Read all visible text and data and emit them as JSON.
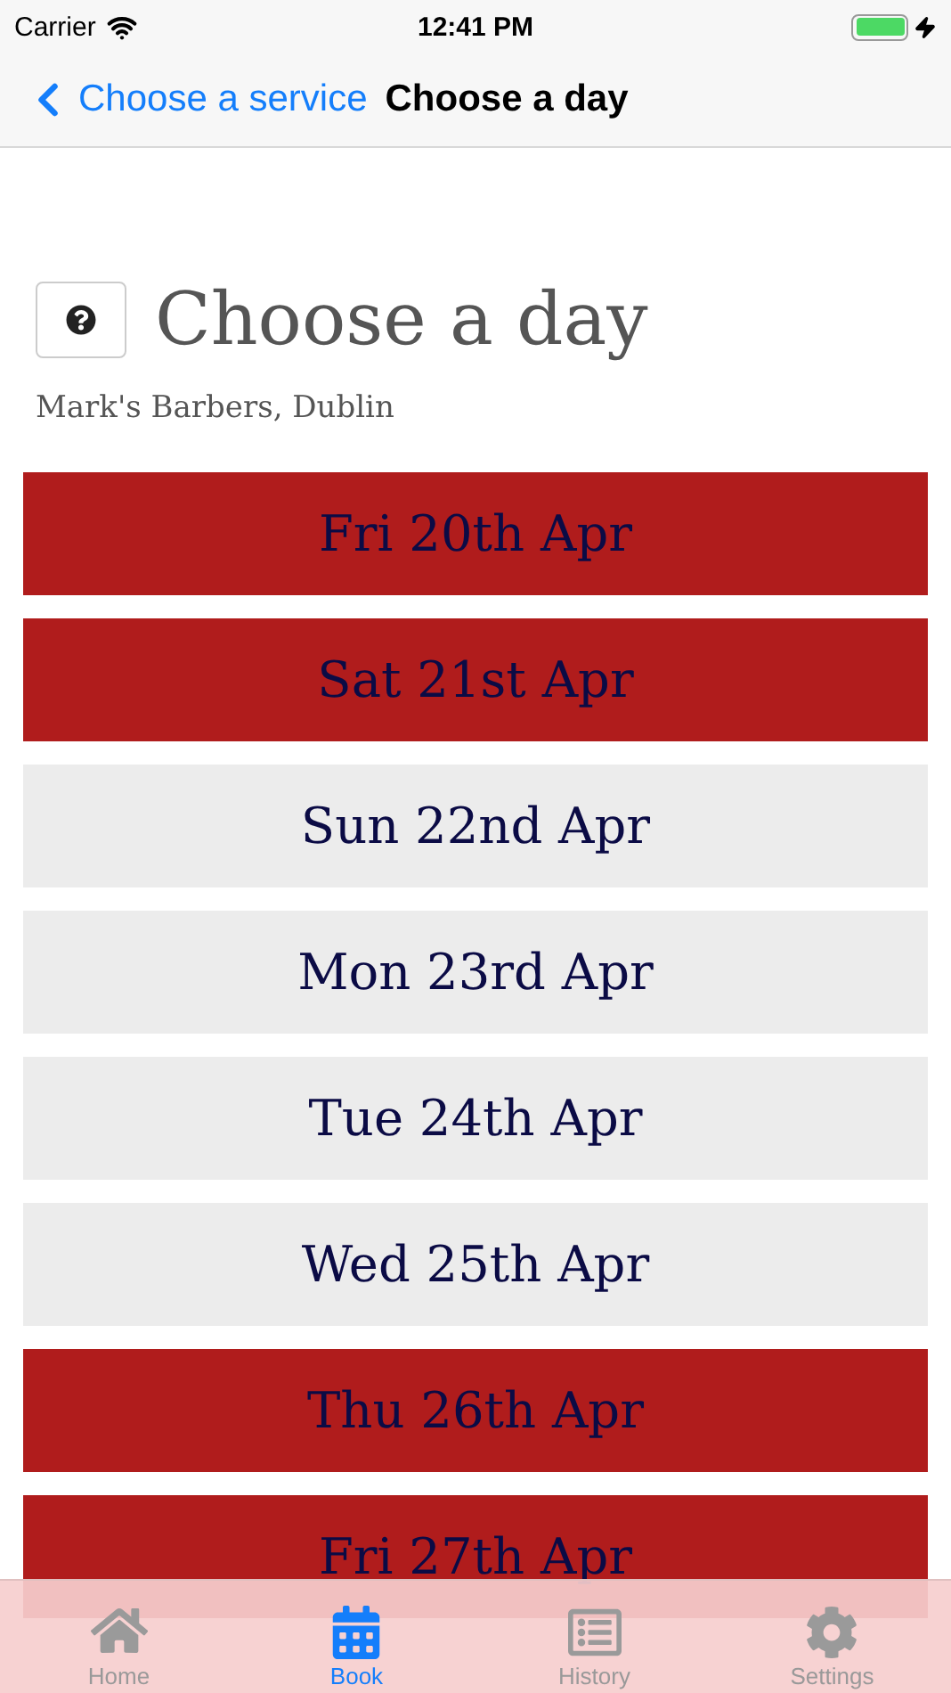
{
  "status_bar": {
    "carrier": "Carrier",
    "time": "12:41 PM",
    "battery": {
      "level": 1,
      "charging": true
    }
  },
  "nav_bar": {
    "back_label": "Choose a service",
    "title": "Choose a day"
  },
  "header": {
    "title": "Choose a day",
    "subtitle": "Mark's Barbers, Dublin"
  },
  "days": [
    {
      "label": "Fri 20th Apr",
      "kind": "unavailable"
    },
    {
      "label": "Sat 21st Apr",
      "kind": "unavailable"
    },
    {
      "label": "Sun 22nd Apr",
      "kind": "available"
    },
    {
      "label": "Mon 23rd Apr",
      "kind": "available"
    },
    {
      "label": "Tue 24th Apr",
      "kind": "available"
    },
    {
      "label": "Wed 25th Apr",
      "kind": "available"
    },
    {
      "label": "Thu 26th Apr",
      "kind": "unavailable"
    },
    {
      "label": "Fri 27th Apr",
      "kind": "unavailable"
    }
  ],
  "tab_bar": [
    {
      "label": "Home",
      "kind": "home",
      "selected": false
    },
    {
      "label": "Book",
      "kind": "calendar",
      "selected": true
    },
    {
      "label": "History",
      "kind": "list",
      "selected": false
    },
    {
      "label": "Settings",
      "kind": "gear",
      "selected": false
    }
  ]
}
